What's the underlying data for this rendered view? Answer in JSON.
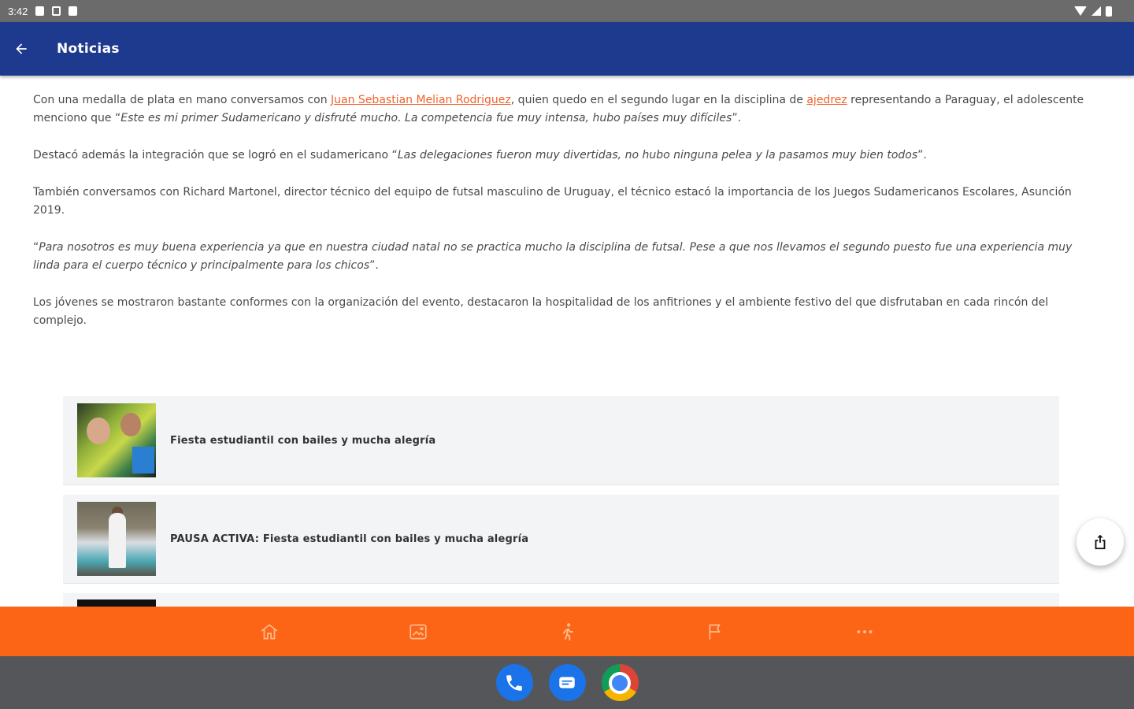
{
  "status_bar": {
    "time": "3:42"
  },
  "app_bar": {
    "title": "Noticias",
    "back_icon": "arrow-back-icon"
  },
  "article": {
    "p1": {
      "before_link1": "Con una medalla de plata en mano conversamos con ",
      "link1": "Juan Sebastian Melian Rodriguez",
      "between_links": ", quien quedo en el segundo lugar en la disciplina de ",
      "link2": "ajedrez",
      "after_link2": " representando a Paraguay, el adolescente menciono que “",
      "quote": "Este es mi primer Sudamericano y disfruté mucho. La competencia fue muy intensa, hubo países muy difíciles",
      "end": "”."
    },
    "p2": {
      "text": "Destacó además la integración que se logró en el sudamericano “",
      "quote": "Las delegaciones fueron muy divertidas, no hubo ninguna pelea y la pasamos muy bien todos",
      "end": "”."
    },
    "p3": "También conversamos con Richard Martonel, director técnico del equipo de futsal masculino de Uruguay, el técnico estacó la importancia de los Juegos Sudamericanos Escolares, Asunción 2019.",
    "p4": {
      "start": "“",
      "quote": "Para nosotros es muy buena experiencia ya que en nuestra ciudad natal no se practica mucho la disciplina de futsal. Pese a que nos llevamos el segundo puesto fue una experiencia muy linda para el cuerpo técnico y principalmente para los chicos",
      "end": "”."
    },
    "p5": "Los jóvenes se mostraron bastante conformes con la organización del evento, destacaron la hospitalidad de los anfitriones y el ambiente festivo del que disfrutaban en cada rincón del complejo."
  },
  "related": [
    {
      "title": "Fiesta estudiantil con bailes y mucha alegría"
    },
    {
      "title": "PAUSA ACTIVA: Fiesta estudiantil con bailes y mucha alegría"
    }
  ],
  "fab": {
    "icon": "share-icon"
  },
  "bottom_nav": [
    {
      "icon": "home-icon"
    },
    {
      "icon": "gallery-icon"
    },
    {
      "icon": "runner-icon"
    },
    {
      "icon": "flag-icon"
    },
    {
      "icon": "more-icon"
    }
  ],
  "dock": [
    {
      "icon": "phone-icon"
    },
    {
      "icon": "messages-icon"
    },
    {
      "icon": "chrome-icon"
    }
  ],
  "colors": {
    "app_bar": "#1e3a8f",
    "accent": "#fd6516",
    "link": "#f0622b"
  }
}
